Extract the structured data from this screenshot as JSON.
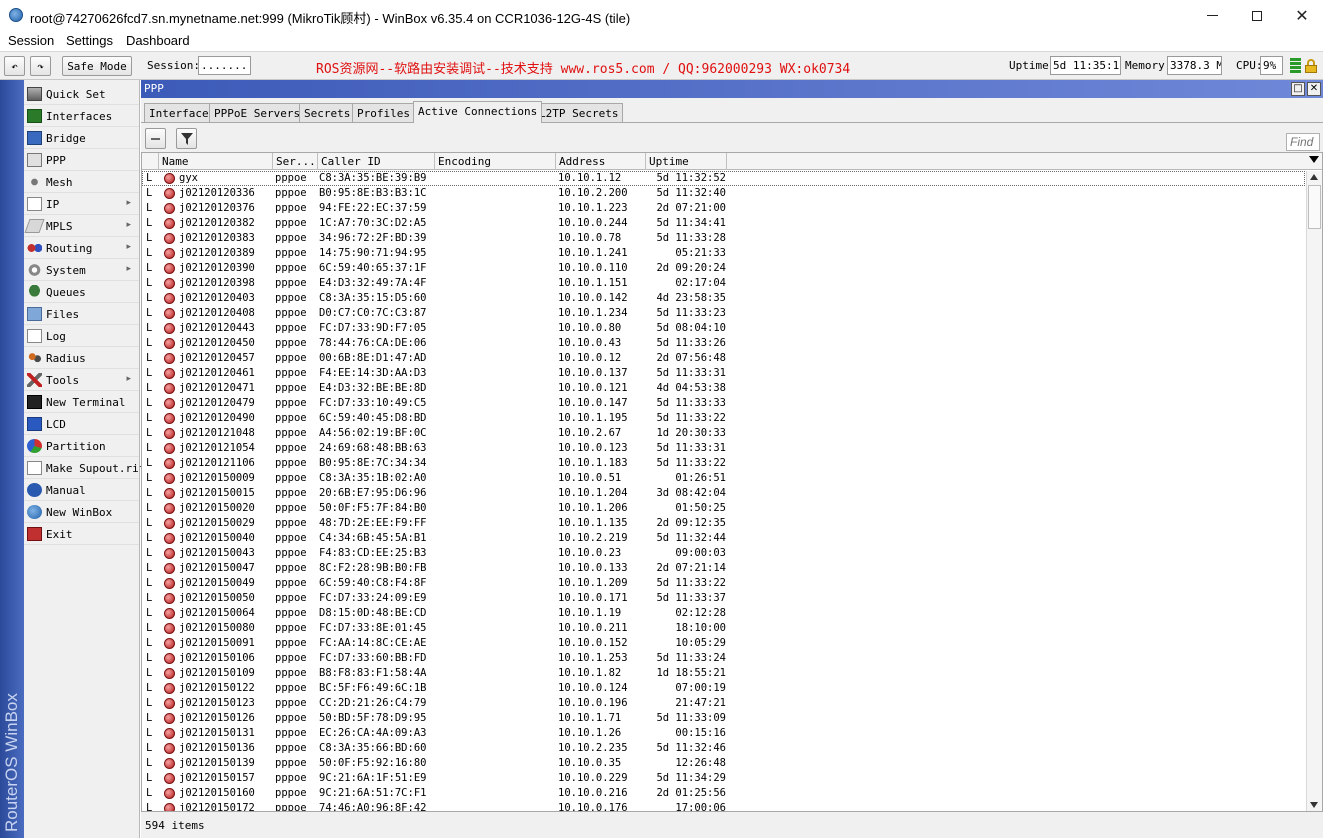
{
  "window": {
    "title": "root@74270626fcd7.sn.mynetname.net:999 (MikroTik顾村) - WinBox v6.35.4 on CCR1036-12G-4S (tile)",
    "controls": {
      "minimize": "—",
      "maximize": "□",
      "close": "✕"
    }
  },
  "menubar": [
    "Session",
    "Settings",
    "Dashboard"
  ],
  "toolbar": {
    "undo_symbol": "↶",
    "redo_symbol": "↷",
    "safe_mode_label": "Safe Mode",
    "session_label": "Session:",
    "session_value": "........",
    "banner": "ROS资源网--软路由安装调试--技术支持 www.ros5.com  /  QQ:962000293  WX:ok0734",
    "uptime_label": "Uptime:",
    "uptime_value": "5d 11:35:19",
    "memory_label": "Memory:",
    "memory_value": "3378.3 MiB",
    "cpu_label": "CPU:",
    "cpu_value": "9%"
  },
  "brand_strip": "RouterOS WinBox",
  "leftmenu": [
    {
      "label": "Quick Set",
      "icon": "quick-set-icon",
      "arrow": false
    },
    {
      "label": "Interfaces",
      "icon": "interfaces-icon",
      "arrow": false
    },
    {
      "label": "Bridge",
      "icon": "bridge-icon",
      "arrow": false
    },
    {
      "label": "PPP",
      "icon": "ppp-icon",
      "arrow": false
    },
    {
      "label": "Mesh",
      "icon": "mesh-icon",
      "arrow": false
    },
    {
      "label": "IP",
      "icon": "ip-icon",
      "arrow": true
    },
    {
      "label": "MPLS",
      "icon": "mpls-icon",
      "arrow": true
    },
    {
      "label": "Routing",
      "icon": "routing-icon",
      "arrow": true
    },
    {
      "label": "System",
      "icon": "system-icon",
      "arrow": true
    },
    {
      "label": "Queues",
      "icon": "queues-icon",
      "arrow": false
    },
    {
      "label": "Files",
      "icon": "files-icon",
      "arrow": false
    },
    {
      "label": "Log",
      "icon": "log-icon",
      "arrow": false
    },
    {
      "label": "Radius",
      "icon": "radius-icon",
      "arrow": false
    },
    {
      "label": "Tools",
      "icon": "tools-icon",
      "arrow": true
    },
    {
      "label": "New Terminal",
      "icon": "terminal-icon",
      "arrow": false
    },
    {
      "label": "LCD",
      "icon": "lcd-icon",
      "arrow": false
    },
    {
      "label": "Partition",
      "icon": "partition-icon",
      "arrow": false
    },
    {
      "label": "Make Supout.rif",
      "icon": "supout-icon",
      "arrow": false
    },
    {
      "label": "Manual",
      "icon": "manual-icon",
      "arrow": false
    },
    {
      "label": "New WinBox",
      "icon": "winbox-icon",
      "arrow": false
    },
    {
      "label": "Exit",
      "icon": "exit-icon",
      "arrow": false
    }
  ],
  "ppp": {
    "title": "PPP",
    "tabs": [
      "Interface",
      "PPPoE Servers",
      "Secrets",
      "Profiles",
      "Active Connections",
      "L2TP Secrets"
    ],
    "active_tab": "Active Connections",
    "find_placeholder": "Find",
    "columns": [
      "Name",
      "Ser...",
      "Caller ID",
      "Encoding",
      "Address",
      "Uptime"
    ],
    "rows": [
      [
        "L",
        "gyx",
        "pppoe",
        "C8:3A:35:BE:39:B9",
        "",
        "10.10.1.12",
        "5d 11:32:52"
      ],
      [
        "L",
        "j02120120336",
        "pppoe",
        "B0:95:8E:B3:B3:1C",
        "",
        "10.10.2.200",
        "5d 11:32:40"
      ],
      [
        "L",
        "j02120120376",
        "pppoe",
        "94:FE:22:EC:37:59",
        "",
        "10.10.1.223",
        "2d 07:21:00"
      ],
      [
        "L",
        "j02120120382",
        "pppoe",
        "1C:A7:70:3C:D2:A5",
        "",
        "10.10.0.244",
        "5d 11:34:41"
      ],
      [
        "L",
        "j02120120383",
        "pppoe",
        "34:96:72:2F:BD:39",
        "",
        "10.10.0.78",
        "5d 11:33:28"
      ],
      [
        "L",
        "j02120120389",
        "pppoe",
        "14:75:90:71:94:95",
        "",
        "10.10.1.241",
        "05:21:33"
      ],
      [
        "L",
        "j02120120390",
        "pppoe",
        "6C:59:40:65:37:1F",
        "",
        "10.10.0.110",
        "2d 09:20:24"
      ],
      [
        "L",
        "j02120120398",
        "pppoe",
        "E4:D3:32:49:7A:4F",
        "",
        "10.10.1.151",
        "02:17:04"
      ],
      [
        "L",
        "j02120120403",
        "pppoe",
        "C8:3A:35:15:D5:60",
        "",
        "10.10.0.142",
        "4d 23:58:35"
      ],
      [
        "L",
        "j02120120408",
        "pppoe",
        "D0:C7:C0:7C:C3:87",
        "",
        "10.10.1.234",
        "5d 11:33:23"
      ],
      [
        "L",
        "j02120120443",
        "pppoe",
        "FC:D7:33:9D:F7:05",
        "",
        "10.10.0.80",
        "5d 08:04:10"
      ],
      [
        "L",
        "j02120120450",
        "pppoe",
        "78:44:76:CA:DE:06",
        "",
        "10.10.0.43",
        "5d 11:33:26"
      ],
      [
        "L",
        "j02120120457",
        "pppoe",
        "00:6B:8E:D1:47:AD",
        "",
        "10.10.0.12",
        "2d 07:56:48"
      ],
      [
        "L",
        "j02120120461",
        "pppoe",
        "F4:EE:14:3D:AA:D3",
        "",
        "10.10.0.137",
        "5d 11:33:31"
      ],
      [
        "L",
        "j02120120471",
        "pppoe",
        "E4:D3:32:BE:BE:8D",
        "",
        "10.10.0.121",
        "4d 04:53:38"
      ],
      [
        "L",
        "j02120120479",
        "pppoe",
        "FC:D7:33:10:49:C5",
        "",
        "10.10.0.147",
        "5d 11:33:33"
      ],
      [
        "L",
        "j02120120490",
        "pppoe",
        "6C:59:40:45:D8:BD",
        "",
        "10.10.1.195",
        "5d 11:33:22"
      ],
      [
        "L",
        "j02120121048",
        "pppoe",
        "A4:56:02:19:BF:0C",
        "",
        "10.10.2.67",
        "1d 20:30:33"
      ],
      [
        "L",
        "j02120121054",
        "pppoe",
        "24:69:68:48:BB:63",
        "",
        "10.10.0.123",
        "5d 11:33:31"
      ],
      [
        "L",
        "j02120121106",
        "pppoe",
        "B0:95:8E:7C:34:34",
        "",
        "10.10.1.183",
        "5d 11:33:22"
      ],
      [
        "L",
        "j02120150009",
        "pppoe",
        "C8:3A:35:1B:02:A0",
        "",
        "10.10.0.51",
        "01:26:51"
      ],
      [
        "L",
        "j02120150015",
        "pppoe",
        "20:6B:E7:95:D6:96",
        "",
        "10.10.1.204",
        "3d 08:42:04"
      ],
      [
        "L",
        "j02120150020",
        "pppoe",
        "50:0F:F5:7F:84:B0",
        "",
        "10.10.1.206",
        "01:50:25"
      ],
      [
        "L",
        "j02120150029",
        "pppoe",
        "48:7D:2E:EE:F9:FF",
        "",
        "10.10.1.135",
        "2d 09:12:35"
      ],
      [
        "L",
        "j02120150040",
        "pppoe",
        "C4:34:6B:45:5A:B1",
        "",
        "10.10.2.219",
        "5d 11:32:44"
      ],
      [
        "L",
        "j02120150043",
        "pppoe",
        "F4:83:CD:EE:25:B3",
        "",
        "10.10.0.23",
        "09:00:03"
      ],
      [
        "L",
        "j02120150047",
        "pppoe",
        "8C:F2:28:9B:B0:FB",
        "",
        "10.10.0.133",
        "2d 07:21:14"
      ],
      [
        "L",
        "j02120150049",
        "pppoe",
        "6C:59:40:C8:F4:8F",
        "",
        "10.10.1.209",
        "5d 11:33:22"
      ],
      [
        "L",
        "j02120150050",
        "pppoe",
        "FC:D7:33:24:09:E9",
        "",
        "10.10.0.171",
        "5d 11:33:37"
      ],
      [
        "L",
        "j02120150064",
        "pppoe",
        "D8:15:0D:48:BE:CD",
        "",
        "10.10.1.19",
        "02:12:28"
      ],
      [
        "L",
        "j02120150080",
        "pppoe",
        "FC:D7:33:8E:01:45",
        "",
        "10.10.0.211",
        "18:10:00"
      ],
      [
        "L",
        "j02120150091",
        "pppoe",
        "FC:AA:14:8C:CE:AE",
        "",
        "10.10.0.152",
        "10:05:29"
      ],
      [
        "L",
        "j02120150106",
        "pppoe",
        "FC:D7:33:60:BB:FD",
        "",
        "10.10.1.253",
        "5d 11:33:24"
      ],
      [
        "L",
        "j02120150109",
        "pppoe",
        "B8:F8:83:F1:58:4A",
        "",
        "10.10.1.82",
        "1d 18:55:21"
      ],
      [
        "L",
        "j02120150122",
        "pppoe",
        "BC:5F:F6:49:6C:1B",
        "",
        "10.10.0.124",
        "07:00:19"
      ],
      [
        "L",
        "j02120150123",
        "pppoe",
        "CC:2D:21:26:C4:79",
        "",
        "10.10.0.196",
        "21:47:21"
      ],
      [
        "L",
        "j02120150126",
        "pppoe",
        "50:BD:5F:78:D9:95",
        "",
        "10.10.1.71",
        "5d 11:33:09"
      ],
      [
        "L",
        "j02120150131",
        "pppoe",
        "EC:26:CA:4A:09:A3",
        "",
        "10.10.1.26",
        "00:15:16"
      ],
      [
        "L",
        "j02120150136",
        "pppoe",
        "C8:3A:35:66:BD:60",
        "",
        "10.10.2.235",
        "5d 11:32:46"
      ],
      [
        "L",
        "j02120150139",
        "pppoe",
        "50:0F:F5:92:16:80",
        "",
        "10.10.0.35",
        "12:26:48"
      ],
      [
        "L",
        "j02120150157",
        "pppoe",
        "9C:21:6A:1F:51:E9",
        "",
        "10.10.0.229",
        "5d 11:34:29"
      ],
      [
        "L",
        "j02120150160",
        "pppoe",
        "9C:21:6A:51:7C:F1",
        "",
        "10.10.0.216",
        "2d 01:25:56"
      ],
      [
        "L",
        "j02120150172",
        "pppoe",
        "74:46:A0:96:8F:42",
        "",
        "10.10.0.176",
        "17:00:06"
      ]
    ],
    "item_count": "594 items"
  }
}
